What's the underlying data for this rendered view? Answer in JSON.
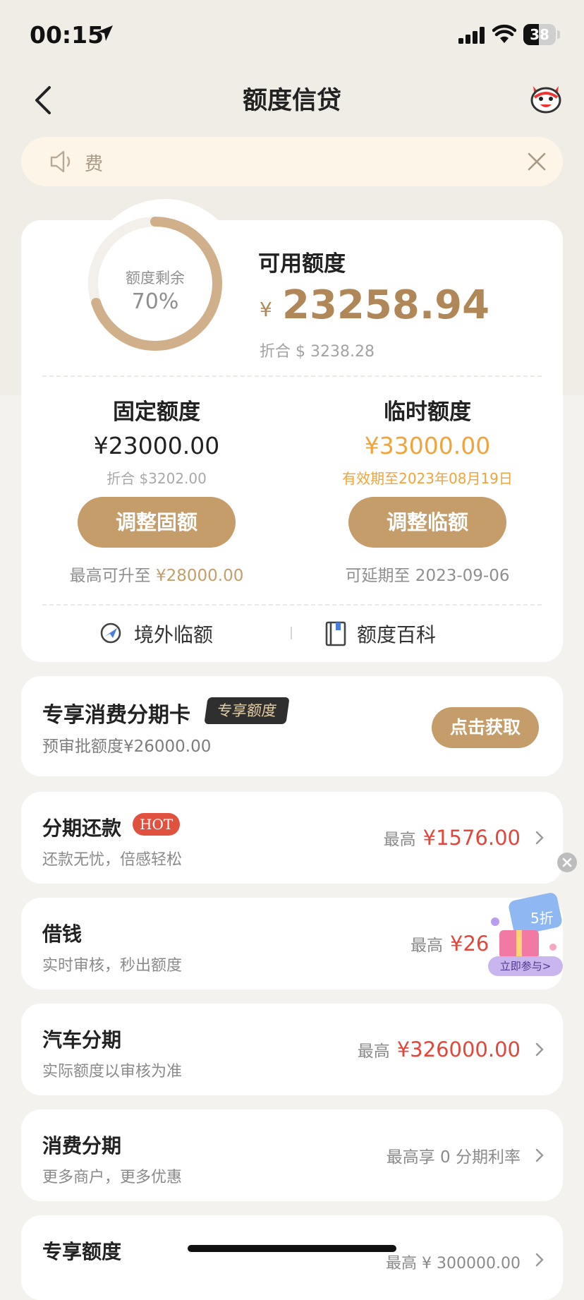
{
  "status": {
    "time": "00:15",
    "battery": "38"
  },
  "nav": {
    "title": "额度信贷"
  },
  "notice": {
    "text": "费"
  },
  "credit": {
    "remaining_label": "额度剩余",
    "remaining_percent": "70%",
    "remaining_fraction": 0.7,
    "available_label": "可用额度",
    "currency_symbol": "¥",
    "available_amount": "23258.94",
    "available_converted": "折合 $ 3238.28",
    "fixed": {
      "title": "固定额度",
      "amount": "¥23000.00",
      "sub": "折合 $3202.00",
      "button": "调整固额",
      "foot_prefix": "最高可升至",
      "foot_value": "¥28000.00"
    },
    "temp": {
      "title": "临时额度",
      "amount": "¥33000.00",
      "sub": "有效期至2023年08月19日",
      "button": "调整临额",
      "foot": "可延期至 2023-09-06"
    },
    "tools": {
      "overseas": "境外临额",
      "wiki": "额度百科"
    }
  },
  "exclusive": {
    "title": "专享消费分期卡",
    "tag": "专享额度",
    "sub": "预审批额度¥26000.00",
    "button": "点击获取"
  },
  "products": [
    {
      "title": "分期还款",
      "badge": "HOT",
      "sub": "还款无忧，倍感轻松",
      "prefix": "最高",
      "value": "¥1576.00"
    },
    {
      "title": "借钱",
      "sub": "实时审核，秒出额度",
      "prefix": "最高",
      "value": "¥26"
    },
    {
      "title": "汽车分期",
      "sub": "实际额度以审核为准",
      "prefix": "最高",
      "value": "¥326000.00"
    },
    {
      "title": "消费分期",
      "sub": "更多商户，更多优惠",
      "plain": "最高享 0 分期利率"
    },
    {
      "title": "专享额度",
      "partial": "最高 ¥ 300000.00"
    }
  ],
  "promo": {
    "discount": "5折",
    "button": "立即参与>"
  },
  "colors": {
    "accent": "#c59d6b",
    "gold_text": "#b08758",
    "orange": "#f0a43a",
    "red": "#e2473b"
  }
}
